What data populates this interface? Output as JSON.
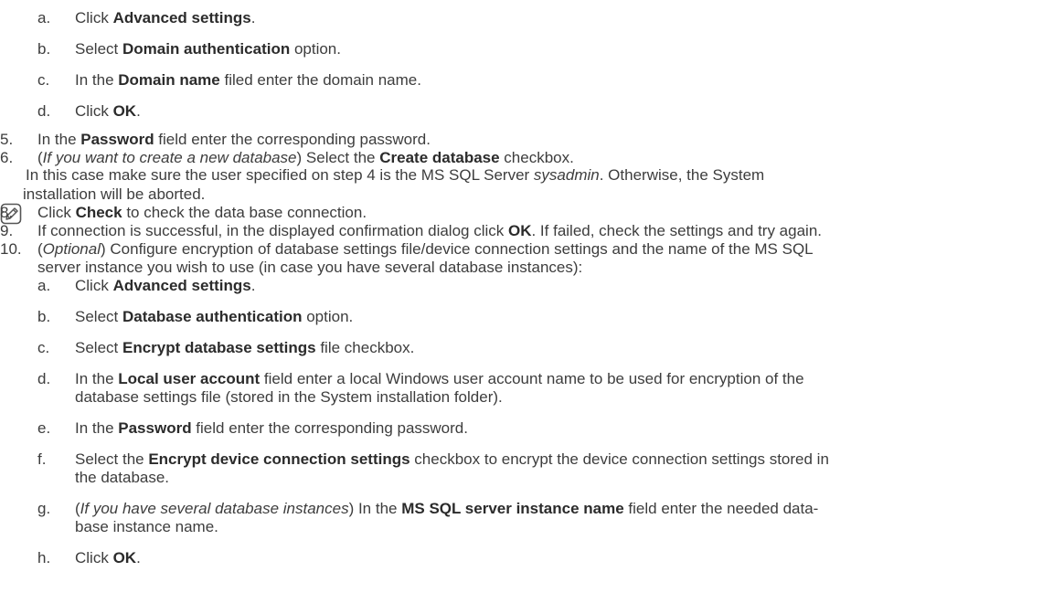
{
  "items": [
    {
      "id": "a1",
      "label": "a.",
      "parts": [
        {
          "t": "Click "
        },
        {
          "t": "Advanced settings",
          "b": true
        },
        {
          "t": "."
        }
      ]
    },
    {
      "id": "b1",
      "label": "b.",
      "parts": [
        {
          "t": "Select "
        },
        {
          "t": "Domain authentication",
          "b": true
        },
        {
          "t": " option."
        }
      ]
    },
    {
      "id": "c1",
      "label": "c.",
      "parts": [
        {
          "t": "In the "
        },
        {
          "t": "Domain name",
          "b": true
        },
        {
          "t": " filed enter the domain name."
        }
      ]
    },
    {
      "id": "d1",
      "label": "d.",
      "parts": [
        {
          "t": "Click "
        },
        {
          "t": "OK",
          "b": true
        },
        {
          "t": "."
        }
      ]
    },
    {
      "id": "s5",
      "label": "5.",
      "parts": [
        {
          "t": "In the "
        },
        {
          "t": "Password",
          "b": true
        },
        {
          "t": " field enter the corresponding password."
        }
      ]
    },
    {
      "id": "s6",
      "label": "6.",
      "parts": [
        {
          "t": "("
        },
        {
          "t": "If you want to create a new database",
          "i": true
        },
        {
          "t": ") Select the "
        },
        {
          "t": "Create database",
          "b": true
        },
        {
          "t": " checkbox."
        }
      ]
    },
    {
      "id": "note1",
      "label": "",
      "parts": [
        {
          "t": " In this case make sure the user specified on step 4 is the MS SQL Server "
        },
        {
          "t": "sysadmin",
          "i": true
        },
        {
          "t": ". Otherwise, the System"
        }
      ]
    },
    {
      "id": "note2",
      "label": "",
      "parts": [
        {
          "t": "installation will be aborted."
        }
      ]
    },
    {
      "id": "s8",
      "label": "8.",
      "parts": [
        {
          "t": "Click "
        },
        {
          "t": "Check",
          "b": true
        },
        {
          "t": " to check the data base connection."
        }
      ]
    },
    {
      "id": "s9",
      "label": "9.",
      "parts": [
        {
          "t": "If connection is successful, in the displayed confirmation dialog click "
        },
        {
          "t": "OK",
          "b": true
        },
        {
          "t": ". If failed, check the settings and try again."
        }
      ]
    },
    {
      "id": "s10a",
      "label": "10.",
      "parts": [
        {
          "t": "("
        },
        {
          "t": "Optional",
          "i": true
        },
        {
          "t": ") Configure encryption of database settings file/device connection settings and the name of the MS SQL"
        }
      ]
    },
    {
      "id": "s10b",
      "label": "",
      "parts": [
        {
          "t": "server instance you wish to use (in case you have several database instances):"
        }
      ]
    },
    {
      "id": "a2",
      "label": "a.",
      "parts": [
        {
          "t": "Click "
        },
        {
          "t": "Advanced settings",
          "b": true
        },
        {
          "t": "."
        }
      ]
    },
    {
      "id": "b2",
      "label": "b.",
      "parts": [
        {
          "t": "Select "
        },
        {
          "t": "Database authentication",
          "b": true
        },
        {
          "t": " option."
        }
      ]
    },
    {
      "id": "c2",
      "label": "c.",
      "parts": [
        {
          "t": "Select "
        },
        {
          "t": "Encrypt database settings",
          "b": true
        },
        {
          "t": " file checkbox."
        }
      ]
    },
    {
      "id": "d2a",
      "label": "d.",
      "parts": [
        {
          "t": "In the "
        },
        {
          "t": "Local user account",
          "b": true
        },
        {
          "t": " field enter a local Windows user account name to be used for encryption of the"
        }
      ]
    },
    {
      "id": "d2b",
      "label": "",
      "parts": [
        {
          "t": "database settings file (stored in the System installation folder)."
        }
      ]
    },
    {
      "id": "e2",
      "label": "e.",
      "parts": [
        {
          "t": "In the "
        },
        {
          "t": "Password",
          "b": true
        },
        {
          "t": " field enter the corresponding password."
        }
      ]
    },
    {
      "id": "f2a",
      "label": "f.",
      "parts": [
        {
          "t": "Select the "
        },
        {
          "t": "Encrypt device connection settings",
          "b": true
        },
        {
          "t": " checkbox to encrypt the device connection settings stored in"
        }
      ]
    },
    {
      "id": "f2b",
      "label": "",
      "parts": [
        {
          "t": "the database."
        }
      ]
    },
    {
      "id": "g2a",
      "label": "g.",
      "parts": [
        {
          "t": "("
        },
        {
          "t": "If you have several database instances",
          "i": true
        },
        {
          "t": ") In the "
        },
        {
          "t": "MS SQL server instance name",
          "b": true
        },
        {
          "t": " field enter the needed data-"
        }
      ]
    },
    {
      "id": "g2b",
      "label": "",
      "parts": [
        {
          "t": "base instance name."
        }
      ]
    },
    {
      "id": "h2",
      "label": "h.",
      "parts": [
        {
          "t": "Click "
        },
        {
          "t": "OK",
          "b": true
        },
        {
          "t": "."
        }
      ]
    }
  ]
}
